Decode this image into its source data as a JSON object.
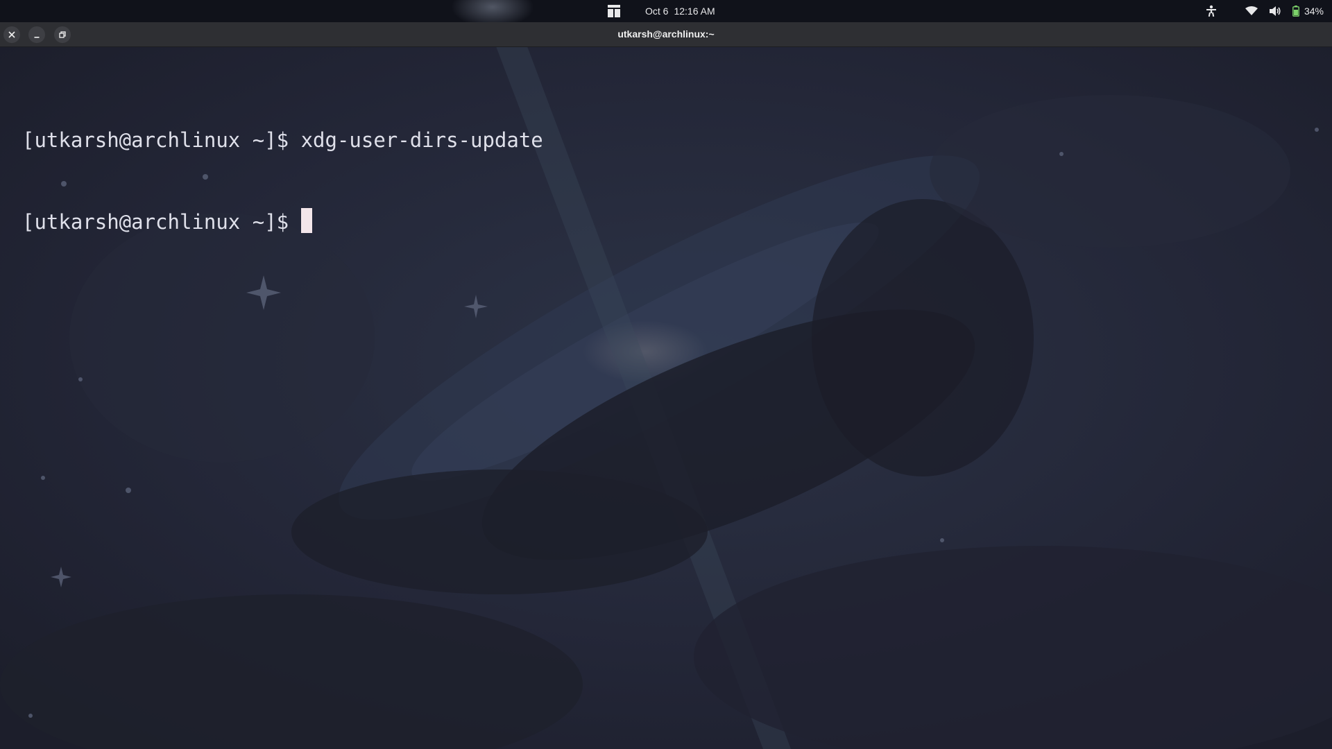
{
  "topbar": {
    "date": "Oct 6",
    "time": "12:16 AM",
    "battery_percent": "34%",
    "icons": [
      "activities-icon",
      "accessibility-icon",
      "wifi-icon",
      "volume-icon",
      "battery-icon"
    ]
  },
  "window": {
    "title": "utkarsh@archlinux:~",
    "buttons": [
      "close-icon",
      "minimize-icon",
      "restore-icon"
    ]
  },
  "terminal": {
    "prompt": "[utkarsh@archlinux ~]$ ",
    "lines": [
      {
        "prompt": "[utkarsh@archlinux ~]$ ",
        "command": "xdg-user-dirs-update"
      },
      {
        "prompt": "[utkarsh@archlinux ~]$ ",
        "command": ""
      }
    ],
    "colors": {
      "text": "#dfe0ea",
      "cursor": "#f3e6ea",
      "background": "#1f2231"
    }
  }
}
